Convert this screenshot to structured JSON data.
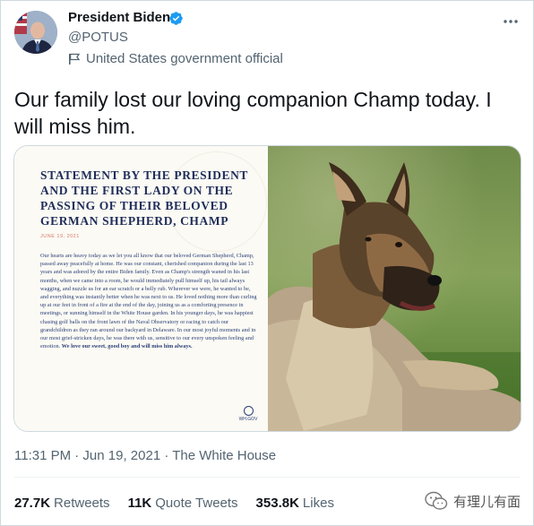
{
  "author": {
    "name": "President Biden",
    "handle": "@POTUS",
    "label": "United States government official"
  },
  "tweet": {
    "text": "Our family lost our loving companion Champ today. I will miss him."
  },
  "statement": {
    "title": "Statement by the President and the First Lady on the Passing of their Beloved German Shepherd, Champ",
    "date": "JUNE 19, 2021",
    "body": "Our hearts are heavy today as we let you all know that our beloved German Shepherd, Champ, passed away peacefully at home. He was our constant, cherished companion during the last 13 years and was adored by the entire Biden family. Even as Champ's strength waned in his last months, when we came into a room, he would immediately pull himself up, his tail always wagging, and nuzzle us for an ear scratch or a belly rub. Wherever we were, he wanted to be, and everything was instantly better when he was next to us. He loved nothing more than curling up at our feet in front of a fire at the end of the day, joining us as a comforting presence in meetings, or sunning himself in the White House garden. In his younger days, he was happiest chasing golf balls on the front lawn of the Naval Observatory or racing to catch our grandchildren as they ran around our backyard in Delaware. In our most joyful moments and in our most grief-stricken days, he was there with us, sensitive to our every unspoken feeling and emotion.",
    "closing": "We love our sweet, good boy and will miss him always.",
    "logo": "WH.GOV"
  },
  "meta": {
    "time": "11:31 PM · Jun 19, 2021 · The White House"
  },
  "stats": [
    {
      "count": "27.7K",
      "label": "Retweets"
    },
    {
      "count": "11K",
      "label": "Quote Tweets"
    },
    {
      "count": "353.8K",
      "label": "Likes"
    }
  ],
  "watermark": {
    "text": "有理儿有面"
  },
  "icons": {
    "verified": "verified-badge-icon",
    "gov": "flag-icon",
    "more": "more-icon"
  },
  "colors": {
    "verified": "#1d9bf0",
    "text": "#0f1419",
    "muted": "#536471",
    "statement_ink": "#2b3f78"
  }
}
